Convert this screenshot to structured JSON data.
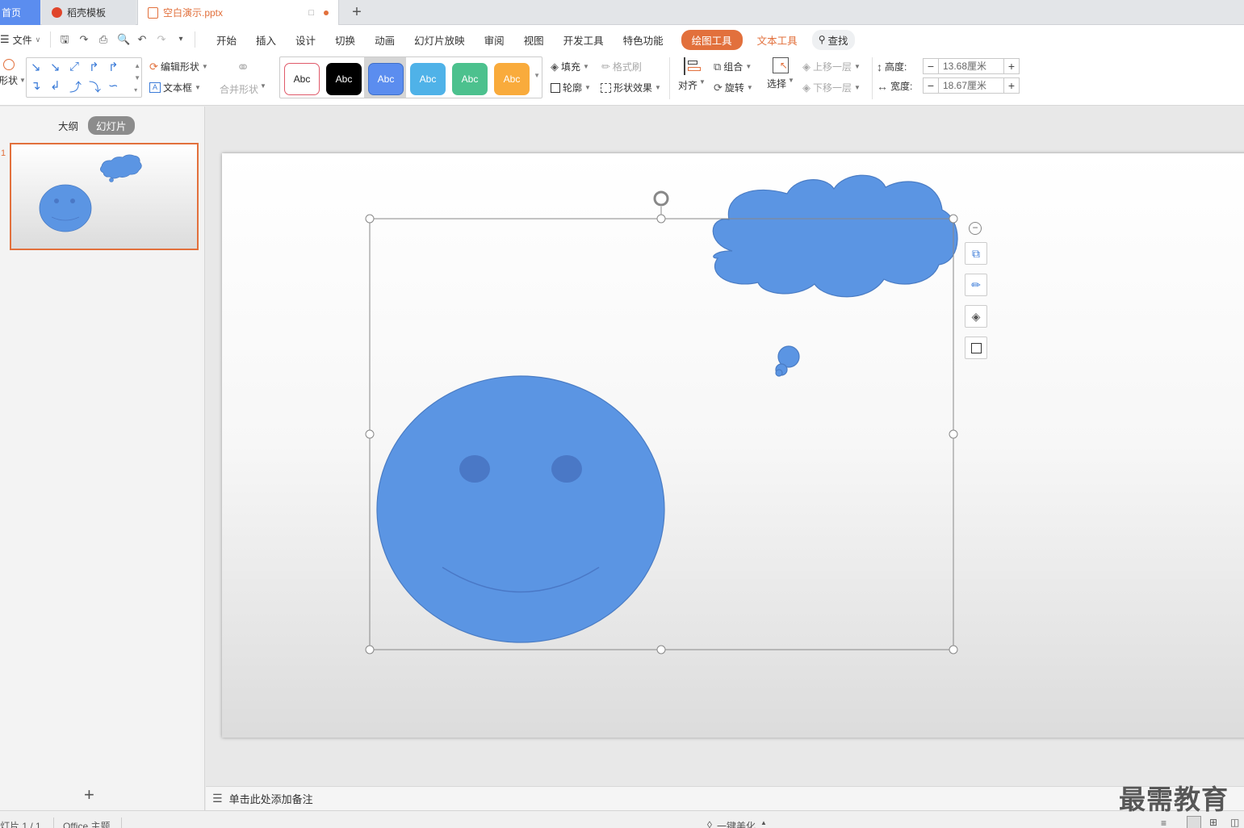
{
  "tabs": {
    "home": "首页",
    "template": "稻壳模板",
    "document": "空白演示.pptx",
    "new_tab": "+"
  },
  "menu": {
    "file": "文件",
    "items": [
      "开始",
      "插入",
      "设计",
      "切换",
      "动画",
      "幻灯片放映",
      "审阅",
      "视图",
      "开发工具",
      "特色功能"
    ],
    "drawing_tools": "绘图工具",
    "text_tools": "文本工具",
    "search": "查找"
  },
  "ribbon": {
    "shape_label": "形状",
    "edit_shape": "编辑形状",
    "text_box": "文本框",
    "merge_shapes": "合并形状",
    "style_samples": [
      "Abc",
      "Abc",
      "Abc",
      "Abc",
      "Abc",
      "Abc"
    ],
    "fill": "填充",
    "format_painter": "格式刷",
    "outline": "轮廓",
    "shape_effects": "形状效果",
    "align": "对齐",
    "group": "组合",
    "rotate": "旋转",
    "select": "选择",
    "bring_forward": "上移一层",
    "send_backward": "下移一层",
    "height_label": "高度:",
    "height_value": "13.68厘米",
    "width_label": "宽度:",
    "width_value": "18.67厘米"
  },
  "left_panel": {
    "outline_tab": "大纲",
    "slides_tab": "幻灯片",
    "slide_number": "1",
    "add_slide": "+"
  },
  "notes": {
    "placeholder": "单击此处添加备注"
  },
  "status": {
    "slide_info": "灯片 1 / 1",
    "theme": "Office 主题",
    "beautify": "一键美化"
  },
  "watermark": "最需教育",
  "colors": {
    "accent": "#e2703c",
    "shape_fill": "#5b95e3",
    "shape_stroke": "#4a7cc4",
    "eye_fill": "#4a78c6",
    "home_tab": "#5b8def"
  }
}
